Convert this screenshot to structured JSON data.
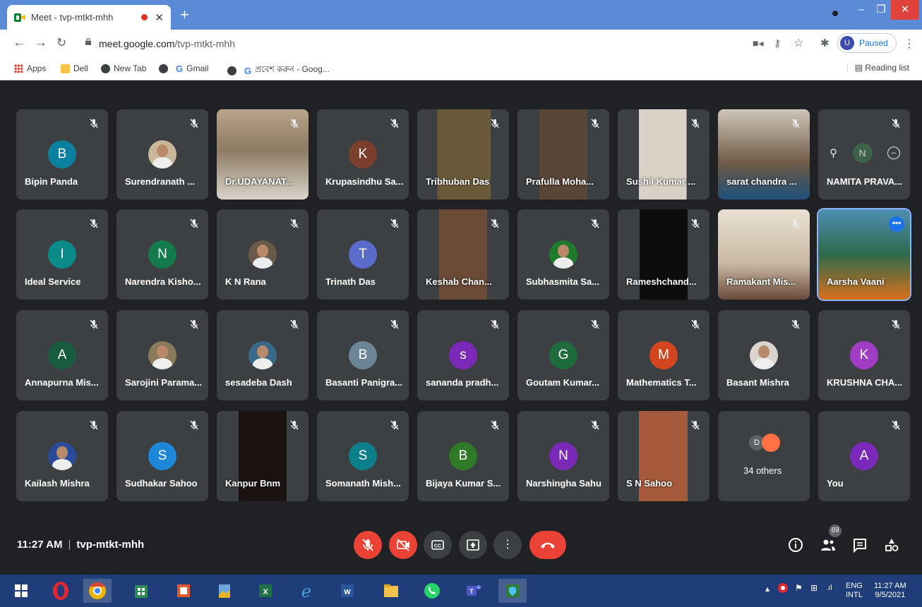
{
  "browser": {
    "tab_title": "Meet - tvp-mtkt-mhh",
    "tab_close": "✕",
    "new_tab": "+",
    "url_host": "meet.google.com",
    "url_path": "/tvp-mtkt-mhh",
    "profile_initial": "U",
    "profile_status": "Paused",
    "bookmarks": [
      "Apps",
      "Dell",
      "New Tab",
      "Gmail",
      "প্রবেশ করুন - Goog..."
    ],
    "reading_list": "Reading list"
  },
  "participants": [
    {
      "name": "Bipin Panda",
      "initial": "B",
      "color": "#0b7f9e",
      "kind": "initial"
    },
    {
      "name": "Surendranath ...",
      "kind": "photo"
    },
    {
      "name": "Dr.UDAYANAT...",
      "kind": "video"
    },
    {
      "name": "Krupasindhu Sa...",
      "initial": "K",
      "color": "#7b3f2e",
      "kind": "initial"
    },
    {
      "name": "Tribhuban Das",
      "kind": "video"
    },
    {
      "name": "Prafulla Moha...",
      "kind": "video"
    },
    {
      "name": "Sushil Kumar ...",
      "kind": "video"
    },
    {
      "name": "sarat chandra ...",
      "kind": "video"
    },
    {
      "name": "NAMITA PRAVA...",
      "initial": "N",
      "kind": "hover"
    },
    {
      "name": "Ideal Service",
      "initial": "I",
      "color": "#0b8a8a",
      "kind": "initial"
    },
    {
      "name": "Narendra Kisho...",
      "initial": "N",
      "color": "#137a4b",
      "kind": "initial"
    },
    {
      "name": "K N Rana",
      "kind": "photo"
    },
    {
      "name": "Trinath Das",
      "initial": "T",
      "color": "#5b6bc9",
      "kind": "initial"
    },
    {
      "name": "Keshab Chan...",
      "kind": "video"
    },
    {
      "name": "Subhasmita Sa...",
      "kind": "photo"
    },
    {
      "name": "Rameshchand...",
      "kind": "video"
    },
    {
      "name": "Ramakant Mis...",
      "kind": "video"
    },
    {
      "name": "Aarsha Vaani",
      "kind": "video"
    },
    {
      "name": "Annapurna Mis...",
      "initial": "A",
      "color": "#175c3e",
      "kind": "initial"
    },
    {
      "name": "Sarojini Parama...",
      "kind": "photo"
    },
    {
      "name": "sesadeba Dash",
      "kind": "photo"
    },
    {
      "name": "Basanti Panigra...",
      "initial": "B",
      "color": "#6b8596",
      "kind": "initial"
    },
    {
      "name": "sananda pradh...",
      "initial": "s",
      "color": "#7b29b8",
      "kind": "initial"
    },
    {
      "name": "Goutam Kumar...",
      "initial": "G",
      "color": "#1e6b3b",
      "kind": "initial"
    },
    {
      "name": "Mathematics T...",
      "initial": "M",
      "color": "#d4461f",
      "kind": "initial"
    },
    {
      "name": "Basant Mishra",
      "kind": "photo"
    },
    {
      "name": "KRUSHNA CHA...",
      "initial": "K",
      "color": "#a13cc4",
      "kind": "initial"
    },
    {
      "name": "Kailash Mishra",
      "kind": "photo"
    },
    {
      "name": "Sudhakar Sahoo",
      "initial": "S",
      "color": "#1e88d8",
      "kind": "initial"
    },
    {
      "name": "Kanpur Bnm",
      "kind": "video"
    },
    {
      "name": "Somanath Mish...",
      "initial": "S",
      "color": "#0b7f8a",
      "kind": "initial"
    },
    {
      "name": "Bijaya Kumar S...",
      "initial": "B",
      "color": "#2f7a26",
      "kind": "initial"
    },
    {
      "name": "Narshingha Sahu",
      "initial": "N",
      "color": "#7b29b8",
      "kind": "initial"
    },
    {
      "name": "S N Sahoo",
      "kind": "video"
    },
    {
      "name": "34 others",
      "initial": "D",
      "kind": "others"
    },
    {
      "name": "You",
      "initial": "A",
      "color": "#7b29b8",
      "kind": "initial"
    }
  ],
  "bottom_bar": {
    "time": "11:27 AM",
    "meeting_code": "tvp-mtkt-mhh",
    "people_count": "69"
  },
  "taskbar": {
    "lang_top": "ENG",
    "lang_bottom": "INTL",
    "time": "11:27 AM",
    "date": "9/5/2021"
  },
  "colors": {
    "meet_bg": "#202124",
    "tile_bg": "#3c4043",
    "danger": "#ea4335",
    "chrome_frame": "#5b8bd6",
    "taskbar": "#1f3d78"
  }
}
